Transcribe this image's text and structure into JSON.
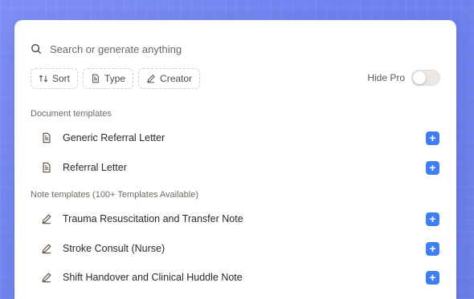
{
  "search": {
    "placeholder": "Search or generate anything"
  },
  "filters": [
    {
      "label": "Sort",
      "icon": "sort-icon"
    },
    {
      "label": "Type",
      "icon": "document-icon"
    },
    {
      "label": "Creator",
      "icon": "pencil-icon"
    }
  ],
  "hide_pro": {
    "label": "Hide Pro",
    "enabled": false
  },
  "sections": {
    "documents": {
      "title": "Document templates",
      "items": [
        {
          "label": "Generic Referral Letter",
          "icon": "document-icon"
        },
        {
          "label": "Referral Letter",
          "icon": "document-icon"
        }
      ]
    },
    "notes": {
      "title": "Note templates (100+ Templates Available)",
      "items": [
        {
          "label": "Trauma Resuscitation and Transfer Note",
          "icon": "pencil-icon"
        },
        {
          "label": "Stroke Consult (Nurse)",
          "icon": "pencil-icon"
        },
        {
          "label": "Shift Handover and Clinical Huddle Note",
          "icon": "pencil-icon"
        }
      ]
    }
  },
  "add_button_label": "+",
  "colors": {
    "accent": "#3f7df4",
    "background": "#7084ee"
  }
}
